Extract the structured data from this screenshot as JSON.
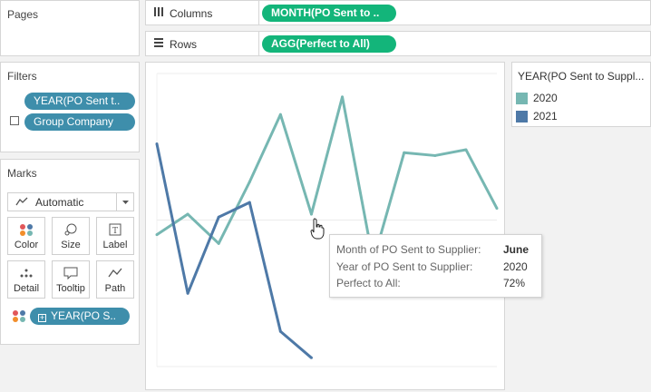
{
  "pages": {
    "title": "Pages"
  },
  "filters": {
    "title": "Filters",
    "pills": [
      "YEAR(PO Sent t..",
      "Group Company"
    ]
  },
  "marks": {
    "title": "Marks",
    "type": "Automatic",
    "buttons": [
      "Color",
      "Size",
      "Label",
      "Detail",
      "Tooltip",
      "Path"
    ],
    "color_pill": "YEAR(PO S.."
  },
  "shelves": {
    "columns": {
      "label": "Columns",
      "pill": "MONTH(PO Sent to .."
    },
    "rows": {
      "label": "Rows",
      "pill": "AGG(Perfect to All)"
    }
  },
  "legend": {
    "title": "YEAR(PO Sent to Suppl...",
    "items": [
      {
        "label": "2020",
        "color": "#76b7b2"
      },
      {
        "label": "2021",
        "color": "#4e79a7"
      }
    ]
  },
  "tooltip": {
    "rows": [
      {
        "key": "Month of PO Sent to Supplier:",
        "value": "June"
      },
      {
        "key": "Year of PO Sent to Supplier:",
        "value": "2020"
      },
      {
        "key": "Perfect to All:",
        "value": "72%"
      }
    ]
  },
  "chart_data": {
    "type": "line",
    "x": [
      1,
      2,
      3,
      4,
      5,
      6,
      7,
      8,
      9,
      10,
      11,
      12
    ],
    "ylim": [
      0,
      1
    ],
    "grid": true,
    "series": [
      {
        "name": "2020",
        "color": "#76b7b2",
        "values": [
          0.45,
          0.52,
          0.42,
          0.63,
          0.86,
          0.52,
          0.92,
          0.36,
          0.73,
          0.72,
          0.74,
          0.54
        ]
      },
      {
        "name": "2021",
        "color": "#4e79a7",
        "values": [
          0.76,
          0.25,
          0.51,
          0.56,
          0.12,
          0.03
        ]
      }
    ]
  }
}
